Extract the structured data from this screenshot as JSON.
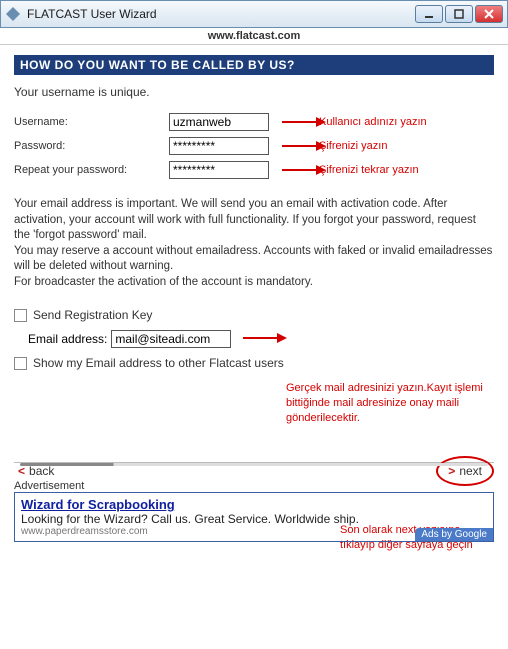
{
  "window": {
    "title": "FLATCAST User Wizard",
    "url": "www.flatcast.com"
  },
  "heading": "HOW DO YOU WANT TO BE CALLED BY US?",
  "intro": "Your username is unique.",
  "fields": {
    "username_label": "Username:",
    "username_value": "uzmanweb",
    "password_label": "Password:",
    "password_value": "*********",
    "repeat_label": "Repeat your password:",
    "repeat_value": "*********"
  },
  "annotations": {
    "username": "Kullanıcı adınızı yazın",
    "password": "Şifrenizi yazın",
    "repeat": "Şifrenizi tekrar yazın",
    "email": "Gerçek mail adresinizi yazın.Kayıt işlemi bittiğinde mail adresinize onay maili gönderilecektir.",
    "next": "Son olarak next yazısına tıklayıp diğer sayfaya geçin"
  },
  "body_text": "Your email address is important. We will send you an email with activation code. After activation, your account will work with full functionality. If you forgot your password, request the 'forgot password' mail.\nYou may reserve a account without emailadress. Accounts with faked or invalid emailadresses will be deleted without warning.\nFor broadcaster the activation of the account is mandatory.",
  "checks": {
    "send_key": "Send Registration Key",
    "email_label": "Email address:",
    "email_value": "mail@siteadi.com",
    "show_email": "Show my Email address to other Flatcast users"
  },
  "nav": {
    "back": "back",
    "next": "next"
  },
  "ad": {
    "label": "Advertisement",
    "title": "Wizard for Scrapbooking",
    "text": "Looking for the Wizard? Call us. Great Service. Worldwide ship.",
    "url": "www.paperdreamsstore.com",
    "by": "Ads by Google"
  }
}
